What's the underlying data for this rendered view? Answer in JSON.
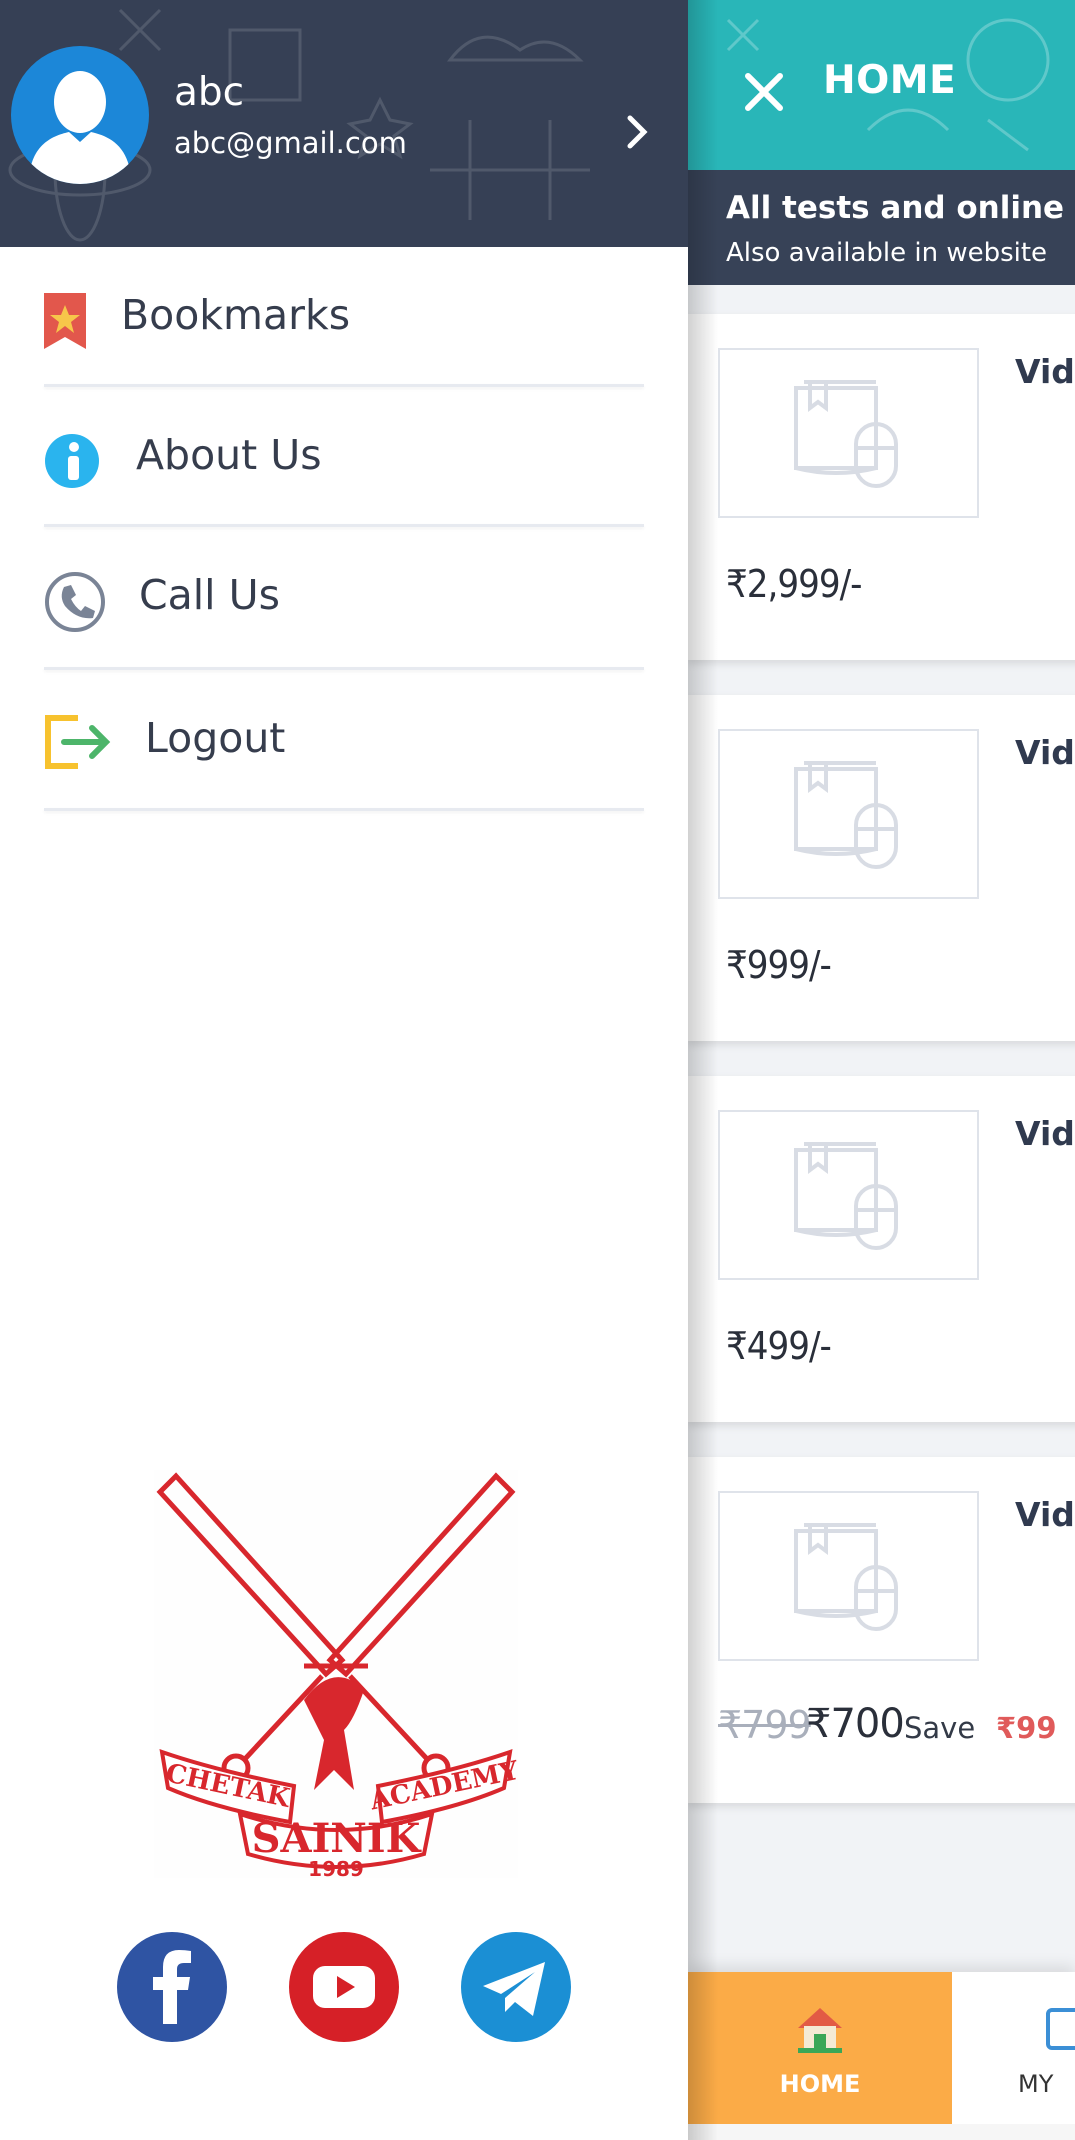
{
  "main": {
    "title": "HOME",
    "banner_title": "All tests and online co",
    "banner_sub": "Also available in website",
    "cards": [
      {
        "title": "Vidu",
        "price": "₹2,999/-"
      },
      {
        "title": "Vidu",
        "price": "₹999/-"
      },
      {
        "title": "Vidu",
        "price": "₹499/-"
      },
      {
        "title": "Vide",
        "old_price": "₹799",
        "new_price": "₹700",
        "save_label": "Save",
        "save_amount": "₹99"
      }
    ],
    "bottom_nav": {
      "home_label": "HOME",
      "my_label": "MY"
    }
  },
  "drawer": {
    "user_name": "abc",
    "user_email": "abc@gmail.com",
    "menu": [
      {
        "label": "Bookmarks",
        "icon": "bookmark-icon"
      },
      {
        "label": "About Us",
        "icon": "info-icon"
      },
      {
        "label": "Call Us",
        "icon": "phone-icon"
      },
      {
        "label": "Logout",
        "icon": "logout-icon"
      }
    ],
    "logo_text": {
      "left": "CHETAK",
      "right": "ACADEMY",
      "center": "SAINIK",
      "year": "1989"
    },
    "social": [
      "facebook-icon",
      "youtube-icon",
      "telegram-icon"
    ]
  },
  "colors": {
    "topbar": "#29b6b8",
    "drawer_header": "#364055",
    "nav_home": "#fbab47",
    "save_amount": "#e05a5a"
  }
}
